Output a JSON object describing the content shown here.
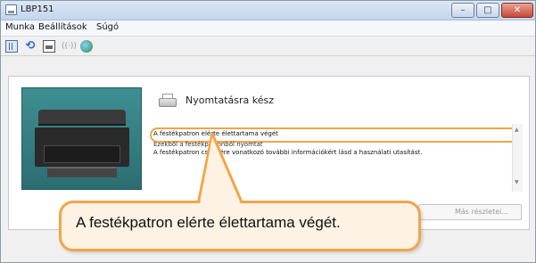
{
  "window": {
    "title": "LBP151",
    "controls": {
      "minimize": "–",
      "maximize": "□",
      "close": "✕"
    }
  },
  "menubar": {
    "items": [
      "Munka",
      "Beállítások",
      "Súgó"
    ]
  },
  "toolbar": {
    "icons": [
      "pause-icon",
      "refresh-icon",
      "print-queue-icon",
      "network-icon",
      "globe-icon"
    ]
  },
  "status": {
    "title": "Nyomtatásra kész"
  },
  "messages": {
    "line1": "A festékpatron elérte élettartama végét",
    "line2": "Ezekből a festékpatronból nyomtat",
    "line3": "A festékpatron cseréjére vonatkozó további információkért lásd a használati utasítást."
  },
  "detail_button": {
    "label": "Más részletei..."
  },
  "callout": {
    "text": "A festékpatron elérte élettartama végét.",
    "accent_color": "#f2a54a"
  }
}
